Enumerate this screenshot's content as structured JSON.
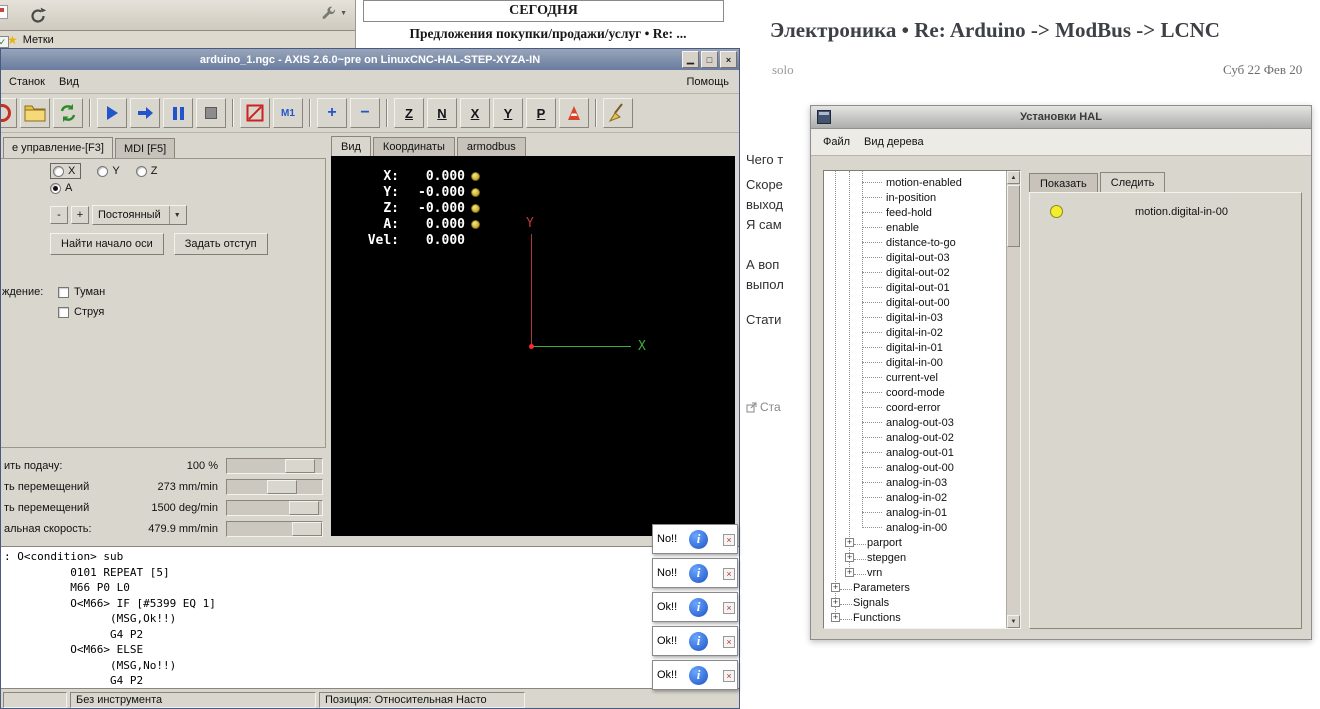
{
  "colors": {
    "axis_titlebar": "#7b8cab",
    "window_bg": "#d9d6cd",
    "preview_bg": "#000000",
    "preview_x_axis": "#3dae3d",
    "preview_y_axis": "#c03a3a",
    "hal_led": "#f2ee2e",
    "info_icon_blue": "#2a62d8",
    "bookmark_star": "#e8b50a"
  },
  "icons": {
    "minimize": "▁",
    "maximize": "□",
    "close": "×",
    "popup_close": "×",
    "info_glyph": "i",
    "bookmark_star": "★",
    "dropdown_arrow": "▼",
    "scroll_up": "▲",
    "scroll_down": "▼",
    "zoom_in": "+",
    "zoom_out": "−",
    "tree_plus": "+",
    "check": "✓"
  },
  "browser_chrome": {
    "bookmarks_label": "Метки"
  },
  "today_panel": {
    "header": "СЕГОДНЯ",
    "headline": "Предложения покупки/продажи/услуг • Re: ..."
  },
  "forum": {
    "title": "Электроника • Re: Arduino -> ModBus -> LCNC",
    "author": "solo",
    "date": "Суб 22 Фев 20",
    "fragments": [
      "Чего т",
      "Скоре",
      "выход",
      "Я сам",
      "А воп",
      "выпол",
      "Стати"
    ],
    "link_fragment": "Ста"
  },
  "axis_window": {
    "title": "arduino_1.ngc - AXIS 2.6.0~pre on LinuxCNC-HAL-STEP-XYZA-IN",
    "menus": [
      "Станок",
      "Вид"
    ],
    "help_menu": "Помощь",
    "toolbar": {
      "view_letters": [
        "Z",
        "N",
        "X",
        "Y",
        "P"
      ],
      "optional_stop_label": "M1"
    },
    "left_tabs": [
      "е управление-[F3]",
      "MDI [F5]"
    ],
    "manual": {
      "axis_radios_row1": [
        "X",
        "Y",
        "Z"
      ],
      "axis_radios_row2": [
        "A"
      ],
      "selected_axis": "A",
      "jog_minus": "-",
      "jog_plus": "+",
      "jog_mode": "Постоянный",
      "home_button": "Найти начало оси",
      "offset_button": "Задать отступ",
      "coolant_label": "ждение:",
      "coolant_checks": [
        "Туман",
        "Струя"
      ]
    },
    "preview_tabs": [
      "Вид",
      "Координаты",
      "armodbus"
    ],
    "dro": [
      {
        "label": "X:",
        "value": "0.000"
      },
      {
        "label": "Y:",
        "value": "-0.000"
      },
      {
        "label": "Z:",
        "value": "-0.000"
      },
      {
        "label": "A:",
        "value": "0.000"
      },
      {
        "label": "Vel:",
        "value": "0.000"
      }
    ],
    "axis_labels": {
      "x": "X",
      "y": "Y"
    },
    "sliders": [
      {
        "label": "ить подачу:",
        "value": "100 %"
      },
      {
        "label": "ть перемещений",
        "value": "273 mm/min"
      },
      {
        "label": "ть перемещений",
        "value": "1500 deg/min"
      },
      {
        "label": "альная скорость:",
        "value": "479.9 mm/min"
      }
    ],
    "gcode": [
      ": O<condition> sub",
      "          0101 REPEAT [5]",
      "          M66 P0 L0",
      "          O<M66> IF [#5399 EQ 1]",
      "                (MSG,Ok!!)",
      "                G4 P2",
      "          O<M66> ELSE",
      "                (MSG,No!!)",
      "                G4 P2"
    ],
    "status": {
      "tool": "Без инструмента",
      "position": "Позиция: Относительная Насто"
    }
  },
  "popups": [
    {
      "label": "No!!"
    },
    {
      "label": "No!!"
    },
    {
      "label": "Ok!!"
    },
    {
      "label": "Ok!!"
    },
    {
      "label": "Ok!!"
    }
  ],
  "hal_window": {
    "title": "Установки HAL",
    "menus": [
      "Файл",
      "Вид дерева"
    ],
    "tree": {
      "pins": [
        "motion-enabled",
        "in-position",
        "feed-hold",
        "enable",
        "distance-to-go",
        "digital-out-03",
        "digital-out-02",
        "digital-out-01",
        "digital-out-00",
        "digital-in-03",
        "digital-in-02",
        "digital-in-01",
        "digital-in-00",
        "current-vel",
        "coord-mode",
        "coord-error",
        "analog-out-03",
        "analog-out-02",
        "analog-out-01",
        "analog-out-00",
        "analog-in-03",
        "analog-in-02",
        "analog-in-01",
        "analog-in-00"
      ],
      "branches": [
        "parport",
        "stepgen",
        "vrn"
      ],
      "roots": [
        "Parameters",
        "Signals",
        "Functions"
      ]
    },
    "tabs": [
      "Показать",
      "Следить"
    ],
    "active_tab": "Следить",
    "watch_item": "motion.digital-in-00"
  }
}
